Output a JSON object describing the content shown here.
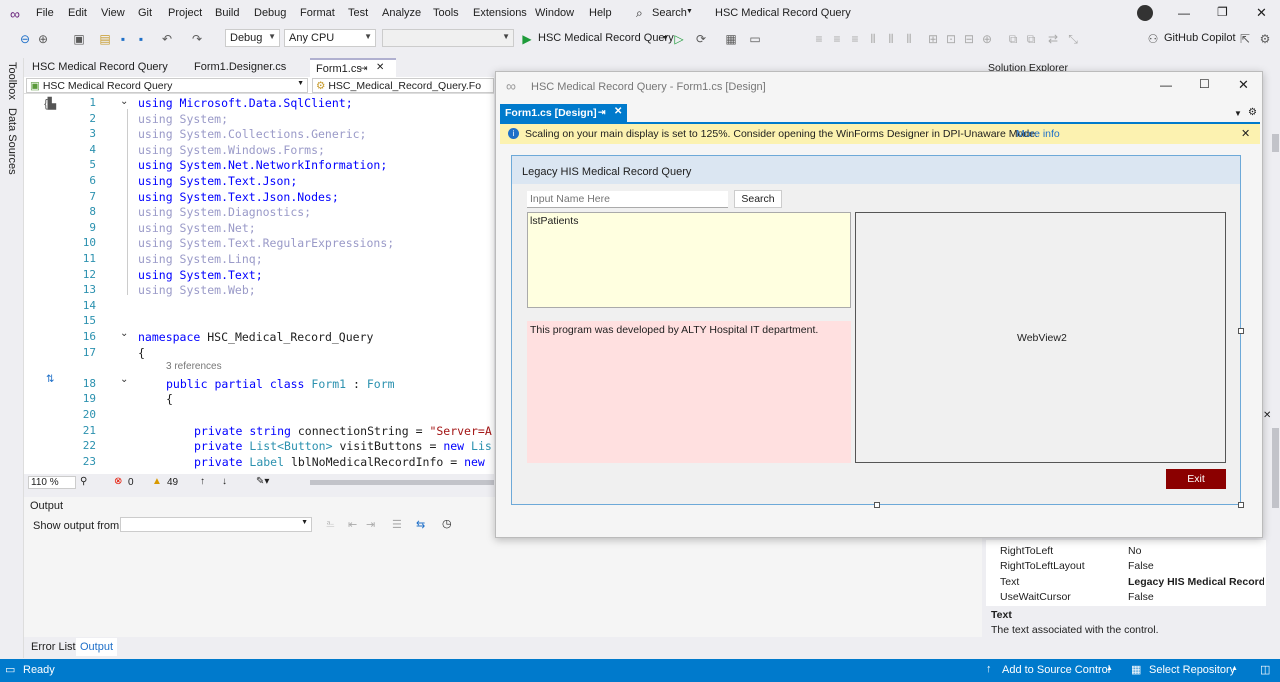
{
  "menu": {
    "items": [
      "File",
      "Edit",
      "View",
      "Git",
      "Project",
      "Build",
      "Debug",
      "Format",
      "Test",
      "Analyze",
      "Tools",
      "Extensions",
      "Window",
      "Help"
    ],
    "search": "Search",
    "title": "HSC Medical Record Query"
  },
  "toolbar": {
    "config": "Debug",
    "platform": "Any CPU",
    "run_label": "HSC Medical Record Query",
    "copilot": "GitHub Copilot"
  },
  "sidebar": {
    "toolbox": "Toolbox",
    "data_sources": "Data Sources"
  },
  "tabs": {
    "project_tab": "HSC Medical Record Query",
    "designer_cs": "Form1.Designer.cs",
    "form1_cs": "Form1.cs"
  },
  "editor_nav": {
    "left": "HSC Medical Record Query",
    "right": "HSC_Medical_Record_Query.Fo"
  },
  "code": {
    "l1": "using Microsoft.Data.SqlClient;",
    "l2": "using System;",
    "l3": "using System.Collections.Generic;",
    "l4": "using System.Windows.Forms;",
    "l5": "using System.Net.NetworkInformation;",
    "l6": "using System.Text.Json;",
    "l7": "using System.Text.Json.Nodes;",
    "l8": "using System.Diagnostics;",
    "l9": "using System.Net;",
    "l10": "using System.Text.RegularExpressions;",
    "l11": "using System.Linq;",
    "l12": "using System.Text;",
    "l13": "using System.Web;",
    "l16a": "namespace",
    "l16b": "HSC_Medical_Record_Query",
    "l17": "{",
    "refs": "3 references",
    "l18a": "public partial class",
    "l18b": "Form1",
    "l18c": ":",
    "l18d": "Form",
    "l19": "{",
    "l21a": "private string",
    "l21b": "connectionString =",
    "l21c": "\"Server=A",
    "l22a": "private",
    "l22b": "List",
    "l22c": "<Button>",
    "l22d": "visitButtons =",
    "l22e": "new",
    "l22f": "Lis",
    "l23a": "private",
    "l23b": "Label",
    "l23c": "lblNoMedicalRecordInfo =",
    "l23d": "new",
    "line_numbers": [
      "1",
      "2",
      "3",
      "4",
      "5",
      "6",
      "7",
      "8",
      "9",
      "10",
      "11",
      "12",
      "13",
      "14",
      "15",
      "16",
      "17",
      "18",
      "19",
      "20",
      "21",
      "22",
      "23"
    ]
  },
  "editor_status": {
    "zoom": "110 %",
    "errors": "0",
    "warnings": "49"
  },
  "output": {
    "title": "Output",
    "show_from": "Show output from:"
  },
  "bottom_tabs": {
    "error_list": "Error List",
    "output": "Output"
  },
  "statusbar": {
    "ready": "Ready",
    "source_control": "Add to Source Control",
    "repo": "Select Repository"
  },
  "right_panel": {
    "solution_explorer": "Solution Explorer",
    "props": [
      {
        "name": "RightToLeft",
        "value": "No"
      },
      {
        "name": "RightToLeftLayout",
        "value": "False"
      },
      {
        "name": "Text",
        "value": "Legacy HIS Medical Record C"
      },
      {
        "name": "UseWaitCursor",
        "value": "False"
      }
    ],
    "desc_title": "Text",
    "desc": "The text associated with the control."
  },
  "designer": {
    "window_title": "HSC Medical Record Query - Form1.cs [Design]",
    "tab": "Form1.cs [Design]",
    "info": "Scaling on your main display is set to 125%. Consider opening the WinForms Designer in DPI-Unaware Mode.",
    "more_info": "More info",
    "form_title": "Legacy HIS Medical Record Query",
    "search_placeholder": "Input Name Here",
    "search_button": "Search",
    "list_label": "lstPatients",
    "info_text": "This program was developed by ALTY Hospital IT department.",
    "webview": "WebView2",
    "exit": "Exit"
  },
  "colors": {
    "accent": "#007acc",
    "exit": "#8b0000",
    "info_bar": "#fcf2b0",
    "list_bg": "#ffffe0",
    "pink": "#ffe0e0"
  }
}
